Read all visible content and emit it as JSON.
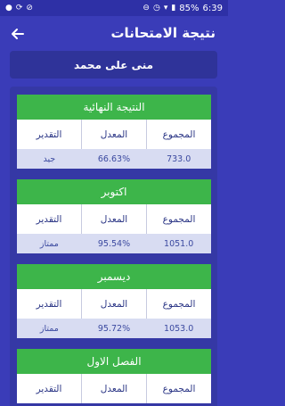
{
  "status_bar": {
    "time": "6:39",
    "battery": "85%",
    "icons_left": [
      "notification-icon",
      "sync-icon",
      "block-icon"
    ],
    "icons_right": [
      "mute-icon",
      "alarm-icon",
      "wifi-icon",
      "battery-icon"
    ]
  },
  "app_bar": {
    "title": "نتيجة الامتحانات",
    "back_icon": "arrow-back-icon"
  },
  "student": {
    "name": "منى على محمد"
  },
  "results": [
    {
      "header": "النتيجة النهائية",
      "labels": {
        "total": "المجموع",
        "average": "المعدل",
        "grade": "التقدير"
      },
      "values": {
        "total": "733.0",
        "average": "66.63%",
        "grade": "جيد"
      }
    },
    {
      "header": "اكتوبر",
      "labels": {
        "total": "المجموع",
        "average": "المعدل",
        "grade": "التقدير"
      },
      "values": {
        "total": "1051.0",
        "average": "95.54%",
        "grade": "ممتاز"
      }
    },
    {
      "header": "ديسمبر",
      "labels": {
        "total": "المجموع",
        "average": "المعدل",
        "grade": "التقدير"
      },
      "values": {
        "total": "1053.0",
        "average": "95.72%",
        "grade": "ممتاز"
      }
    },
    {
      "header": "الفصل الاول",
      "labels": {
        "total": "المجموع",
        "average": "المعدل",
        "grade": "التقدير"
      },
      "values": {
        "total": "",
        "average": "",
        "grade": ""
      }
    }
  ],
  "colors": {
    "background": "#3a3cb8",
    "card_header": "#3db54a",
    "values_row": "#d8dcf2",
    "name_card": "#2f3399"
  }
}
